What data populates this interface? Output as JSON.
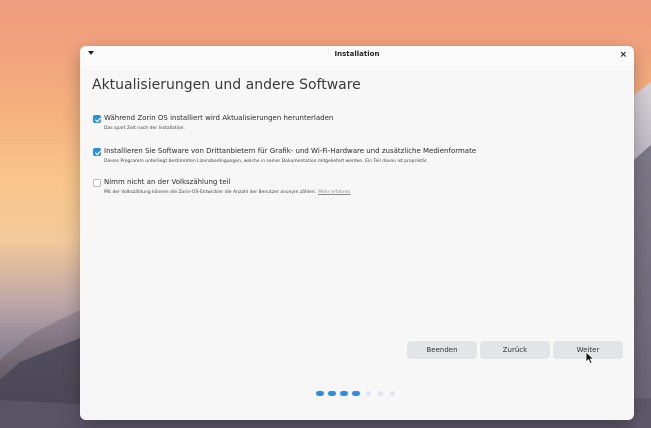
{
  "window": {
    "title": "Installation",
    "close_symbol": "×",
    "menu_icon": "chevron-down-icon"
  },
  "page": {
    "heading": "Aktualisierungen und andere Software"
  },
  "options": [
    {
      "label": "Während Zorin OS installiert wird Aktualisierungen herunterladen",
      "description": "Das spart Zeit nach der Installation.",
      "checked": true
    },
    {
      "label": "Installieren Sie Software von Drittanbietern für Grafik- und Wi-Fi-Hardware und zusätzliche Medienformate",
      "description": "Dieses Programm unterliegt bestimmten Lizenzbedingungen, welche in seiner Dokumentation mitgeliefert werden. Ein Teil davon ist proprietär.",
      "checked": true
    },
    {
      "label": "Nimm nicht an der Volkszählung teil",
      "description": "Mit der Volkszählung können die Zorin-OS-Entwickler die Anzahl der Benutzer anonym zählen.",
      "link": "Mehr erfahren",
      "checked": false
    }
  ],
  "buttons": {
    "quit": "Beenden",
    "back": "Zurück",
    "next": "Weiter"
  },
  "progress": {
    "total_steps": 8,
    "completed_steps": 4
  },
  "colors": {
    "accent": "#2a8fe0",
    "window_bg": "#f7f7f8",
    "button_bg": "#e3e4e7"
  }
}
